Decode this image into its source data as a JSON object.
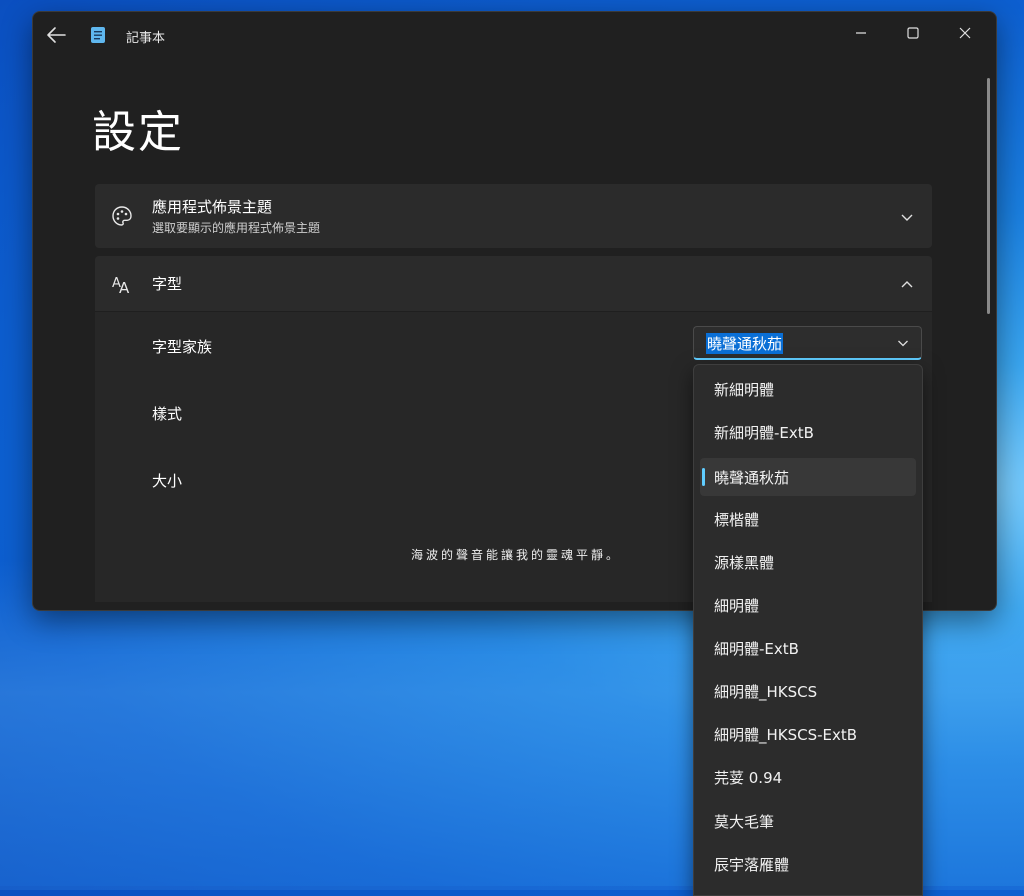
{
  "window": {
    "app_name": "記事本",
    "page_title": "設定"
  },
  "theme_card": {
    "title": "應用程式佈景主題",
    "subtitle": "選取要顯示的應用程式佈景主題"
  },
  "font_card": {
    "title": "字型",
    "family_label": "字型家族",
    "style_label": "樣式",
    "size_label": "大小",
    "selected_family": "曉聲通秋茄",
    "preview_text": "海波的聲音能讓我的靈魂平靜。"
  },
  "dropdown": {
    "options": [
      "新細明體",
      "新細明體-ExtB",
      "曉聲通秋茄",
      "標楷體",
      "源樣黑體",
      "細明體",
      "細明體-ExtB",
      "細明體_HKSCS",
      "細明體_HKSCS-ExtB",
      "芫荽 0.94",
      "莫大毛筆",
      "辰宇落雁體"
    ],
    "selected_index": 2
  },
  "colors": {
    "accent": "#60cdff",
    "window_bg": "#202020",
    "card_bg": "#2b2b2b"
  }
}
